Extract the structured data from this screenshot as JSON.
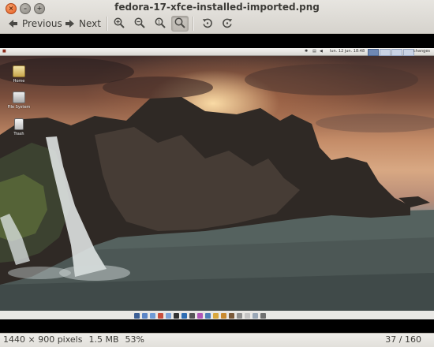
{
  "window": {
    "title": "fedora-17-xfce-installed-imported.png"
  },
  "toolbar": {
    "previous_label": "Previous",
    "next_label": "Next"
  },
  "screenshot": {
    "panel_clock": "lun. 12 jun. 18:48",
    "panel_user": "changes",
    "desktop_icons": [
      {
        "label": "Home"
      },
      {
        "label": "File System"
      },
      {
        "label": "Trash"
      }
    ]
  },
  "statusbar": {
    "dimensions": "1440 × 900 pixels",
    "size": "1.5 MB",
    "zoom": "53%",
    "position": "37 / 160"
  },
  "colors": {
    "accent_close": "#e65a1e",
    "chrome_bg": "#dcd9d3",
    "viewer_bg": "#000000"
  }
}
